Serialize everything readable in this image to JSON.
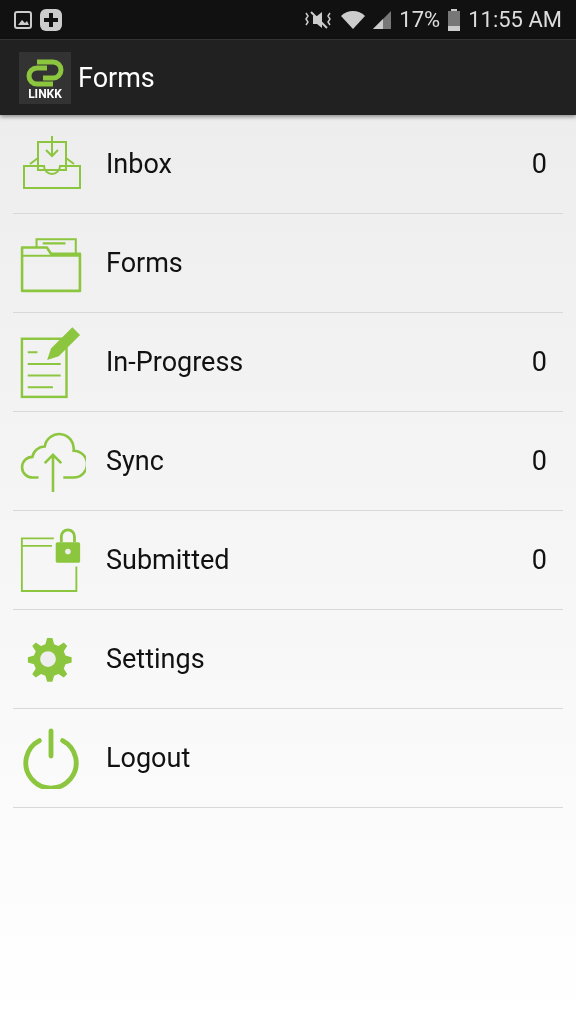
{
  "status_bar": {
    "battery": "17%",
    "time": "11:55 AM"
  },
  "app_bar": {
    "logo_text": "LINKK",
    "title": "Forms"
  },
  "menu": [
    {
      "kind": "inbox",
      "label": "Inbox",
      "count": "0"
    },
    {
      "kind": "forms",
      "label": "Forms"
    },
    {
      "kind": "progress",
      "label": "In-Progress",
      "count": "0"
    },
    {
      "kind": "sync",
      "label": "Sync",
      "count": "0"
    },
    {
      "kind": "submitted",
      "label": "Submitted",
      "count": "0"
    },
    {
      "kind": "settings",
      "label": "Settings"
    },
    {
      "kind": "logout",
      "label": "Logout"
    }
  ]
}
